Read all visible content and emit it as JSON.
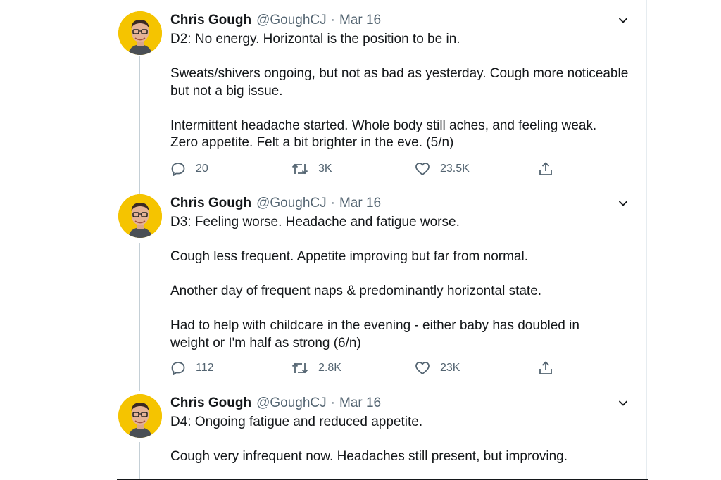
{
  "tweets": [
    {
      "author_name": "Chris Gough",
      "handle": "@GoughCJ",
      "separator": "·",
      "date": "Mar 16",
      "paragraphs": [
        "D2: No energy. Horizontal is the position to be in.",
        "Sweats/shivers ongoing, but not as bad as yesterday. Cough more noticeable\nbut not a big issue.",
        "Intermittent headache started. Whole body still aches, and feeling weak.\nZero appetite. Felt a bit brighter in the eve. (5/n)"
      ],
      "replies": "20",
      "retweets": "3K",
      "likes": "23.5K"
    },
    {
      "author_name": "Chris Gough",
      "handle": "@GoughCJ",
      "separator": "·",
      "date": "Mar 16",
      "paragraphs": [
        "D3: Feeling worse. Headache and fatigue worse.",
        "Cough less frequent. Appetite improving but far from normal.",
        "Another day of frequent naps & predominantly horizontal state.",
        "Had to help with childcare in the evening - either baby has doubled in\nweight or I'm half as strong (6/n)"
      ],
      "replies": "112",
      "retweets": "2.8K",
      "likes": "23K"
    },
    {
      "author_name": "Chris Gough",
      "handle": "@GoughCJ",
      "separator": "·",
      "date": "Mar 16",
      "paragraphs": [
        "D4: Ongoing fatigue and reduced appetite.",
        "Cough very infrequent now. Headaches still present, but improving."
      ]
    }
  ],
  "colors": {
    "text": "#14171a",
    "secondary": "#536471",
    "thread_line": "#c4cfd6",
    "avatar_bg": "#f5c400"
  },
  "icons": {
    "more": "chevron-down-icon",
    "reply": "reply-icon",
    "retweet": "retweet-icon",
    "like": "heart-icon",
    "share": "share-icon"
  }
}
